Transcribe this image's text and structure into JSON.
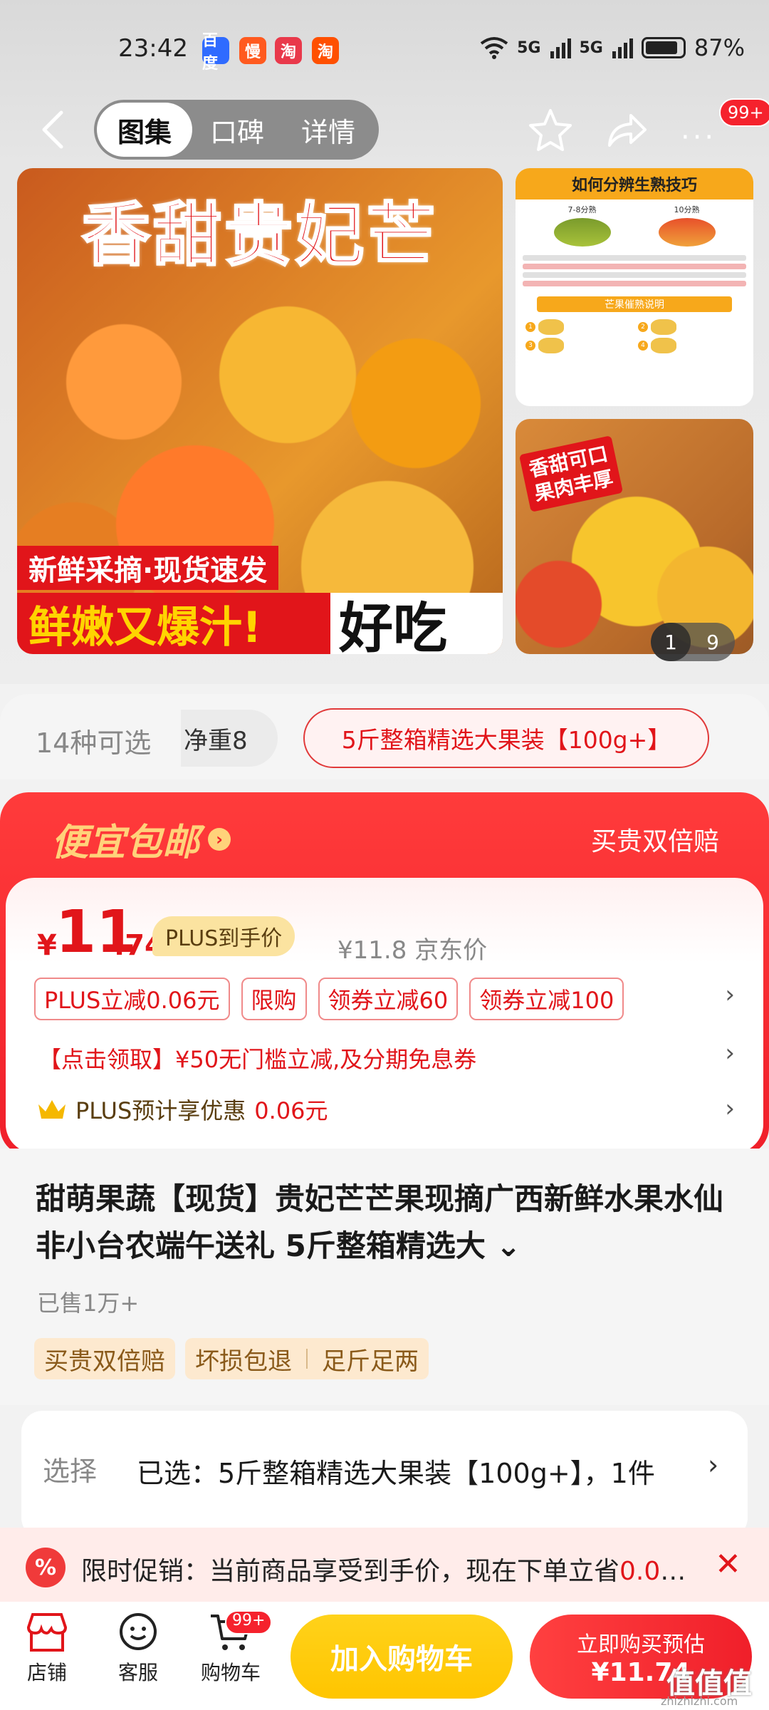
{
  "status_bar": {
    "time": "23:42",
    "apps": [
      "百度",
      "慢",
      "淘",
      "淘"
    ],
    "network": "5G",
    "battery": "87%"
  },
  "nav": {
    "tabs": [
      "图集",
      "口碑",
      "详情"
    ],
    "active_tab": "图集",
    "badge": "99+",
    "more": "···"
  },
  "gallery": {
    "main_title": "香甜贵妃芒",
    "main_sub": "新鲜采摘·现货速发",
    "main_bottom_red": "鲜嫩又爆汁!",
    "main_bottom_black": "好吃",
    "side1_title": "如何分辨生熟技巧",
    "side1_label_a": "7-8分熟",
    "side1_label_b": "10分熟",
    "side1_band": "芒果催熟说明",
    "side2_tag_line1": "香甜可口",
    "side2_tag_line2": "果肉丰厚",
    "counter_current": "1",
    "counter_total": "9"
  },
  "variants": {
    "count_label": "14种可选",
    "chip_partial": "净重8",
    "chip_selected": "5斤整箱精选大果装【100g+】"
  },
  "promo": {
    "title": "便宜包邮",
    "title_arrow": "›",
    "right_text": "买贵双倍赔",
    "price_yen": "¥",
    "price_int": "11",
    "price_dec": ".74",
    "plus_pill": "PLUS到手价",
    "jd_price": "¥11.8",
    "jd_label": "京东价",
    "coupons": [
      "PLUS立减0.06元",
      "限购",
      "领券立减60",
      "领券立减100"
    ],
    "coupon_line": "【点击领取】¥50无门槛立减,及分期免息券",
    "plus_line_prefix": "PLUS预计享优惠",
    "plus_line_amount": "0.06元",
    "chevron": "›"
  },
  "product": {
    "title": "甜萌果蔬【现货】贵妃芒芒果现摘广西新鲜水果水仙非小台农端午送礼 5斤整箱精选大",
    "title_expand": "⌄",
    "sold": "已售1万+",
    "tag1": "买贵双倍赔",
    "tag2a": "坏损包退",
    "tag2b": "足斤足两"
  },
  "select": {
    "label": "选择",
    "value": "已选：5斤整箱精选大果装【100g+】，1件",
    "chevron": "›"
  },
  "limited_promo": {
    "icon": "%",
    "text": "限时促销：当前商品享受到手价，现在下单立省",
    "amount": "0.06...",
    "close": "✕"
  },
  "bottom_bar": {
    "shop": "店铺",
    "service": "客服",
    "cart": "购物车",
    "cart_badge": "99+",
    "add_cart": "加入购物车",
    "buy_line1": "立即购买预估",
    "buy_line2": "¥11.74"
  },
  "watermark": {
    "main": "值值值",
    "sub": "zhizhizhi.com"
  }
}
